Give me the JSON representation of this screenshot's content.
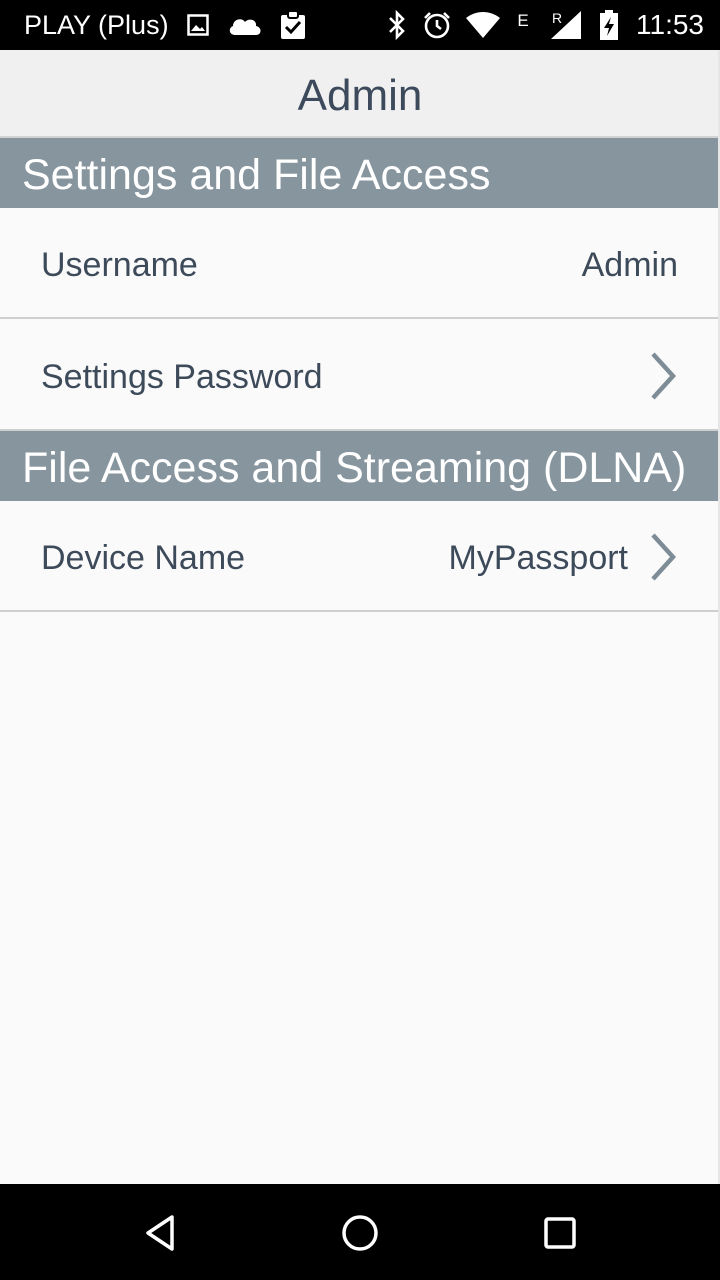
{
  "status_bar": {
    "carrier": "PLAY (Plus)",
    "time": "11:53",
    "network_type_label": "E",
    "roaming_label": "R",
    "icons": [
      "image-icon",
      "cloud-icon",
      "clipboard-check-icon",
      "bluetooth-icon",
      "alarm-icon",
      "wifi-icon",
      "signal-icon",
      "battery-charging-icon"
    ]
  },
  "app_bar": {
    "title": "Admin"
  },
  "sections": [
    {
      "title": "Settings and File Access",
      "rows": [
        {
          "label": "Username",
          "value": "Admin",
          "has_chevron": false
        },
        {
          "label": "Settings Password",
          "value": "",
          "has_chevron": true
        }
      ]
    },
    {
      "title": "File Access and Streaming (DLNA)",
      "rows": [
        {
          "label": "Device Name",
          "value": "MyPassport",
          "has_chevron": true
        }
      ]
    }
  ],
  "nav_bar": {
    "buttons": [
      "back-icon",
      "home-icon",
      "recents-icon"
    ]
  },
  "colors": {
    "status_bar_bg": "#000000",
    "app_bar_bg": "#f0f0f0",
    "section_header_bg": "#86959e",
    "text": "#3d4a5a",
    "chevron": "#7d8c96"
  }
}
